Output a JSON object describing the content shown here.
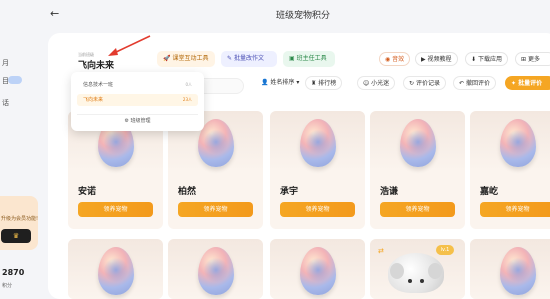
{
  "header": {
    "page_title": "班级宠物积分",
    "back_icon": "arrow-left-icon"
  },
  "left_strip": {
    "partial_text_1": "月",
    "partial_text_2": "目",
    "partial_text_3": "话",
    "promo_text": "升级为会员功能!",
    "promo_button_icon": "♛",
    "points": "2870",
    "small_text": "积分"
  },
  "class_info": {
    "subtitle": "当前班级",
    "name": "飞向未来"
  },
  "tools": {
    "interact": "课堂互动工具",
    "homework": "批量改作文",
    "teacher": "班主任工具"
  },
  "top_actions": {
    "sound": "音效",
    "video": "视频教程",
    "download": "下载应用",
    "more": "更多"
  },
  "toolbar": {
    "sort": "姓名排序",
    "rank": "排行榜",
    "group": "小光迷",
    "record": "评价记录",
    "undo": "撤回评价",
    "batch": "批量评价"
  },
  "dropdown": {
    "items": [
      {
        "label": "信息技术一班",
        "count": "0人"
      },
      {
        "label": "飞向未来",
        "count": "23人"
      }
    ],
    "manage": "班级管理"
  },
  "students": [
    {
      "name": "安诺",
      "button": "领养宠物"
    },
    {
      "name": "柏然",
      "button": "领养宠物"
    },
    {
      "name": "承宇",
      "button": "领养宠物"
    },
    {
      "name": "浩谦",
      "button": "领养宠物"
    },
    {
      "name": "嘉屹",
      "button": "领养宠物"
    }
  ],
  "second_row": {
    "badge": "lv.1"
  },
  "colors": {
    "accent": "#f5a623",
    "card_bg": "#fbf4ee"
  }
}
